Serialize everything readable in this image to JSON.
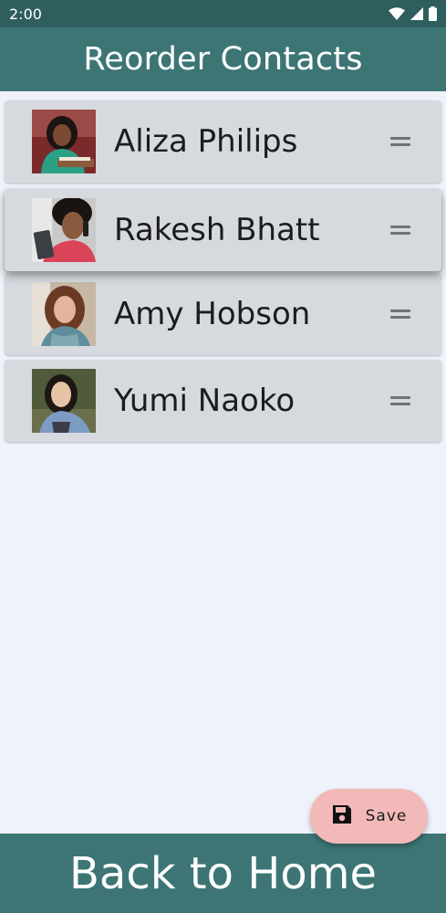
{
  "status_bar": {
    "time": "2:00",
    "icons": [
      "wifi-icon",
      "signal-icon",
      "battery-icon"
    ]
  },
  "app_bar": {
    "title": "Reorder Contacts"
  },
  "contacts": [
    {
      "name": "Aliza Philips",
      "avatar": "aliza-philips-photo",
      "dragging": false
    },
    {
      "name": "Rakesh Bhatt",
      "avatar": "rakesh-bhatt-photo",
      "dragging": true
    },
    {
      "name": "Amy Hobson",
      "avatar": "amy-hobson-photo",
      "dragging": false
    },
    {
      "name": "Yumi Naoko",
      "avatar": "yumi-naoko-photo",
      "dragging": false
    }
  ],
  "fab": {
    "label": "Save",
    "icon": "save-icon"
  },
  "bottom_button": {
    "label": "Back to Home"
  },
  "colors": {
    "status_bar": "#2f5e5e",
    "app_bar": "#3d7575",
    "background": "#eff2fa",
    "card": "#d6dadf",
    "fab": "#f2b9b8"
  }
}
